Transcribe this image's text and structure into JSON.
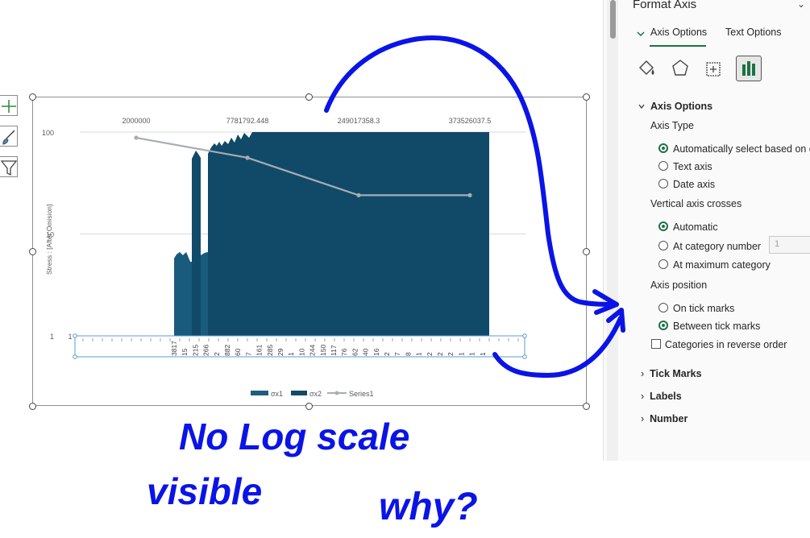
{
  "panel": {
    "title": "Format Axis",
    "tabs": [
      "Axis Options",
      "Text Options"
    ],
    "section_header": "Axis Options",
    "axis_type": {
      "label": "Axis Type",
      "options": [
        "Automatically select based on da",
        "Text axis",
        "Date axis"
      ],
      "selected": 0
    },
    "vertical_crosses": {
      "label": "Vertical axis crosses",
      "options": [
        "Automatic",
        "At category number",
        "At maximum category"
      ],
      "selected": 0,
      "category_number_value": "1"
    },
    "axis_position": {
      "label": "Axis position",
      "options": [
        "On tick marks",
        "Between tick marks"
      ],
      "selected": 1
    },
    "reverse_label": "Categories in reverse order",
    "collapsed_sections": [
      "Tick Marks",
      "Labels",
      "Number"
    ],
    "icons": [
      "fill-line-icon",
      "effects-icon",
      "size-properties-icon",
      "axis-options-icon"
    ],
    "accent_color": "#1e7145"
  },
  "chart": {
    "top_labels": [
      "2000000",
      "7781792.448",
      "249017358.3",
      "373526037.5"
    ],
    "y_ticks": [
      "100",
      "10",
      "1"
    ],
    "y_axis_title": "Stress : [After Omision]",
    "x_tick_labels": [
      "3817",
      "15",
      "215",
      "266",
      "2",
      "882",
      "60",
      "7",
      "161",
      "285",
      "29",
      "1",
      "10",
      "244",
      "150",
      "117",
      "76",
      "62",
      "40",
      "16",
      "2",
      "7",
      "8",
      "1",
      "2",
      "2",
      "2",
      "1",
      "1",
      "1"
    ],
    "legend": [
      "σx1",
      "σx2",
      "Series1"
    ]
  },
  "chart_data": {
    "type": "bar",
    "title": "",
    "ylabel": "Stress : [After Omision]",
    "yscale": "log",
    "ylim": [
      1,
      100
    ],
    "series": [
      {
        "name": "σx1",
        "type": "bar",
        "color": "#1b5e80"
      },
      {
        "name": "σx2",
        "type": "bar",
        "color": "#114a68"
      },
      {
        "name": "Series1",
        "type": "line",
        "color": "#a6adb4",
        "x": [
          "2000000",
          "7781792.448",
          "249017358.3",
          "373526037.5"
        ],
        "values": [
          88,
          56,
          24,
          24
        ]
      }
    ]
  },
  "annotation": {
    "line1": "No Log scale",
    "line2": "visible",
    "line3": "why?",
    "ink_color": "#0a14e6"
  },
  "side_tools": [
    "chart-elements-icon",
    "chart-styles-icon",
    "chart-filters-icon"
  ]
}
